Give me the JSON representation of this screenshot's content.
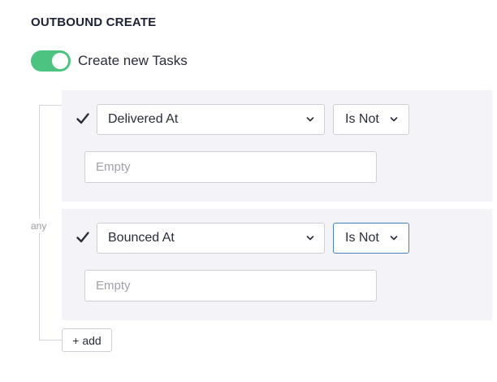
{
  "section": {
    "title": "OUTBOUND CREATE"
  },
  "toggle": {
    "label": "Create new Tasks",
    "on": true,
    "color": "#4cc47f"
  },
  "group": {
    "join_label": "any"
  },
  "conditions": [
    {
      "checked": true,
      "field": "Delivered At",
      "operator": "Is Not",
      "value_placeholder": "Empty",
      "value": ""
    },
    {
      "checked": true,
      "field": "Bounced At",
      "operator": "Is Not",
      "value_placeholder": "Empty",
      "value": ""
    }
  ],
  "add_button": {
    "label": "+ add"
  },
  "icons": {
    "check": "checkmark-icon",
    "chevron": "chevron-down-icon"
  },
  "colors": {
    "accent_green": "#4cc47f",
    "focus_blue": "#4a7fc0",
    "card_bg": "#f4f3f7"
  }
}
